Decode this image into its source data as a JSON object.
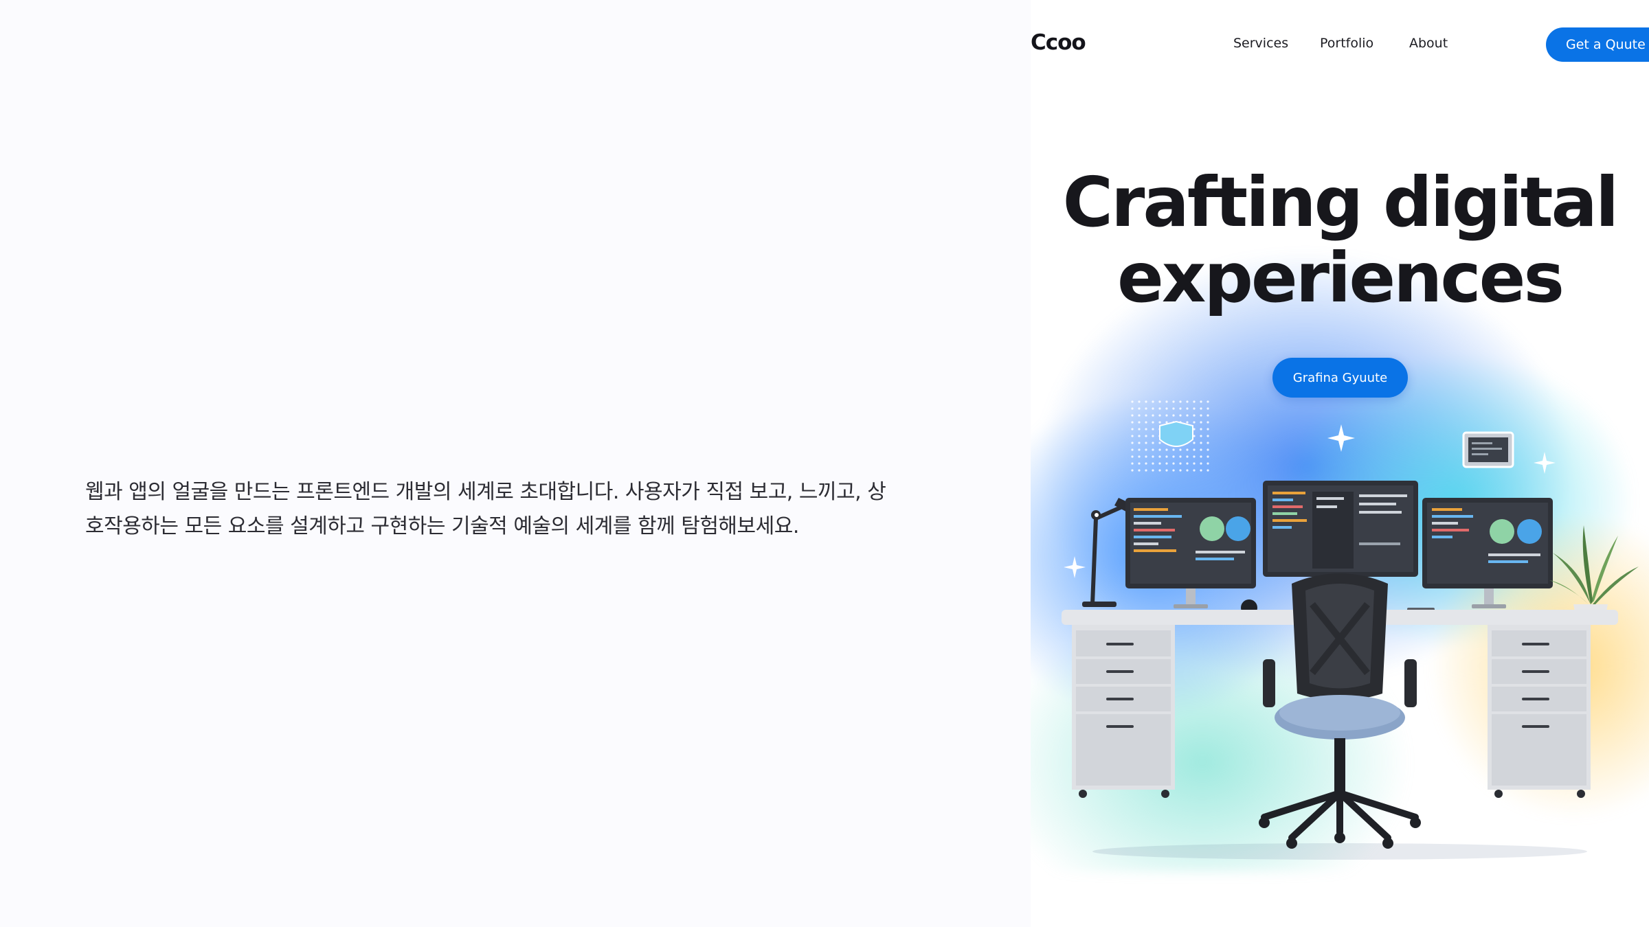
{
  "intro": {
    "line1": "웹과 앱의 얼굴을 만드는 프론트엔드 개발의 세계로 초대합니다. 사용자가 직접 보고, 느끼고, 상",
    "line2": "호작용하는 모든 요소를 설계하고 구현하는 기술적 예술의 세계를 함께 탐험해보세요."
  },
  "nav": {
    "logo": "Ccoo",
    "services": "Services",
    "portfolio": "Portfolio",
    "about": "About",
    "quote_button": "Get a Quute"
  },
  "hero": {
    "title_line1": "Crafting digital",
    "title_line2": "experiences",
    "cta": "Grafina Gyuute"
  },
  "colors": {
    "accent": "#0a73e6",
    "text_dark": "#17171c",
    "background": "#fbfbfe"
  },
  "icons": [
    "sparkle-icon",
    "circle-target-icon",
    "shield-badge-icon",
    "dot-grid-icon"
  ]
}
